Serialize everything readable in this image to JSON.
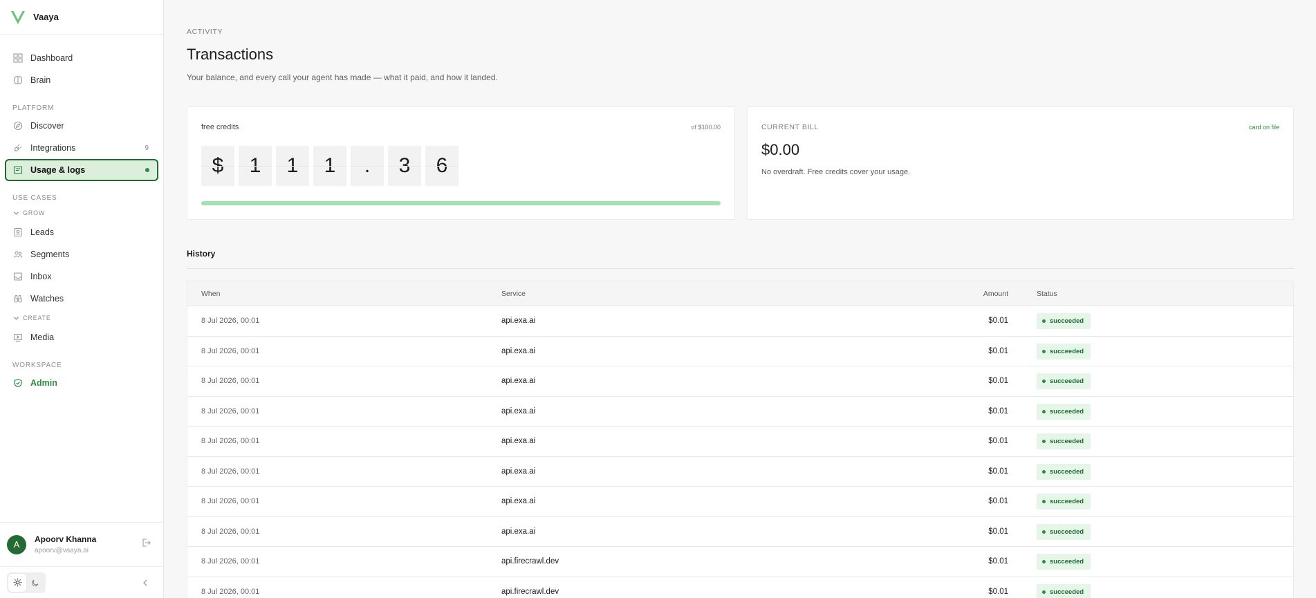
{
  "brand": {
    "name": "Vaaya",
    "accent": "#4caf50"
  },
  "nav": {
    "top_items": [
      {
        "label": "Dashboard",
        "icon": "grid-icon"
      },
      {
        "label": "Brain",
        "icon": "brain-icon"
      }
    ],
    "platform_label": "PLATFORM",
    "platform_items": [
      {
        "label": "Discover",
        "icon": "compass-icon"
      },
      {
        "label": "Integrations",
        "icon": "plug-icon",
        "count": "9"
      },
      {
        "label": "Usage & logs",
        "icon": "receipt-icon",
        "active": true
      }
    ],
    "use_cases_label": "USE CASES",
    "grow_label": "GROW",
    "grow_items": [
      {
        "label": "Leads",
        "icon": "contact-icon"
      },
      {
        "label": "Segments",
        "icon": "users-icon"
      },
      {
        "label": "Inbox",
        "icon": "inbox-icon"
      },
      {
        "label": "Watches",
        "icon": "binoculars-icon"
      }
    ],
    "create_label": "CREATE",
    "create_items": [
      {
        "label": "Media",
        "icon": "play-icon"
      }
    ],
    "workspace_label": "WORKSPACE",
    "workspace_items": [
      {
        "label": "Admin",
        "icon": "shield-check-icon"
      }
    ]
  },
  "user": {
    "initial": "A",
    "name": "Apoorv Khanna",
    "email": "apoorv@vaaya.ai"
  },
  "page": {
    "eyebrow": "ACTIVITY",
    "title": "Transactions",
    "subtitle": "Your balance, and every call your agent has made — what it paid, and how it landed."
  },
  "credits": {
    "label": "free credits",
    "of_label": "of $100.00",
    "digits": [
      "$",
      "1",
      "1",
      "1",
      ".",
      "3",
      "6"
    ],
    "progress_fraction": 1.0
  },
  "bill": {
    "label": "CURRENT BILL",
    "link": "card on file",
    "amount": "$0.00",
    "note": "No overdraft. Free credits cover your usage."
  },
  "history": {
    "title": "History",
    "columns": {
      "when": "When",
      "service": "Service",
      "amount": "Amount",
      "status": "Status"
    },
    "rows": [
      {
        "when": "8 Jul 2026, 00:01",
        "service": "api.exa.ai",
        "amount": "$0.01",
        "status": "succeeded"
      },
      {
        "when": "8 Jul 2026, 00:01",
        "service": "api.exa.ai",
        "amount": "$0.01",
        "status": "succeeded"
      },
      {
        "when": "8 Jul 2026, 00:01",
        "service": "api.exa.ai",
        "amount": "$0.01",
        "status": "succeeded"
      },
      {
        "when": "8 Jul 2026, 00:01",
        "service": "api.exa.ai",
        "amount": "$0.01",
        "status": "succeeded"
      },
      {
        "when": "8 Jul 2026, 00:01",
        "service": "api.exa.ai",
        "amount": "$0.01",
        "status": "succeeded"
      },
      {
        "when": "8 Jul 2026, 00:01",
        "service": "api.exa.ai",
        "amount": "$0.01",
        "status": "succeeded"
      },
      {
        "when": "8 Jul 2026, 00:01",
        "service": "api.exa.ai",
        "amount": "$0.01",
        "status": "succeeded"
      },
      {
        "when": "8 Jul 2026, 00:01",
        "service": "api.exa.ai",
        "amount": "$0.01",
        "status": "succeeded"
      },
      {
        "when": "8 Jul 2026, 00:01",
        "service": "api.firecrawl.dev",
        "amount": "$0.01",
        "status": "succeeded"
      },
      {
        "when": "8 Jul 2026, 00:01",
        "service": "api.firecrawl.dev",
        "amount": "$0.01",
        "status": "succeeded"
      }
    ]
  }
}
